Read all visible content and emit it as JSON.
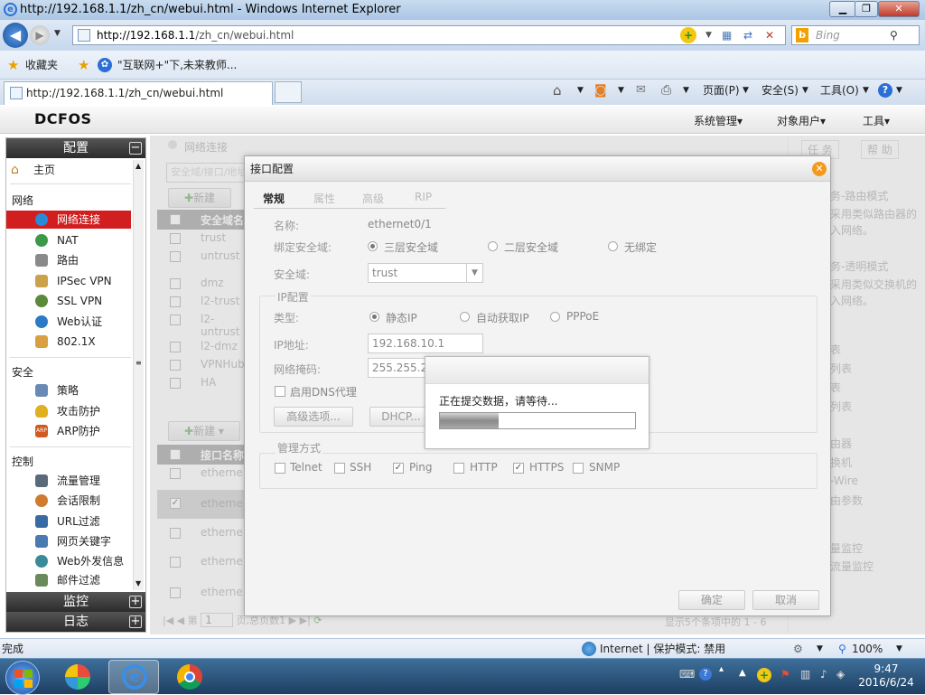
{
  "browser": {
    "title": "http://192.168.1.1/zh_cn/webui.html - Windows Internet Explorer",
    "address_host": "http://192.168.1.1",
    "address_path": "/zh_cn/webui.html",
    "search_placeholder": "Bing",
    "favorites_label": "收藏夹",
    "fav_link": "\"互联网+\"下,未来教师...",
    "tab_title": "http://192.168.1.1/zh_cn/webui.html",
    "cmd_page": "页面(P)",
    "cmd_safety": "安全(S)",
    "cmd_tools": "工具(O)"
  },
  "app": {
    "logo": "DCFOS",
    "menu_system": "系统管理",
    "menu_objects": "对象用户",
    "menu_tools": "工具"
  },
  "sidebar": {
    "config": "配置",
    "home": "主页",
    "group_network": "网络",
    "network_items": [
      "网络连接",
      "NAT",
      "路由",
      "IPSec VPN",
      "SSL VPN",
      "Web认证",
      "802.1X"
    ],
    "group_security": "安全",
    "security_items": [
      "策略",
      "攻击防护",
      "ARP防护"
    ],
    "group_control": "控制",
    "control_items": [
      "流量管理",
      "会话限制",
      "URL过滤",
      "网页关键字",
      "Web外发信息",
      "邮件过滤"
    ],
    "monitor": "监控",
    "log": "日志"
  },
  "main": {
    "breadcrumb": "网络连接",
    "search_hint": "安全域/接口/地址",
    "new_btn": "新建",
    "col_zone": "安全域名",
    "zones": [
      "trust",
      "untrust",
      "dmz",
      "l2-trust",
      "l2-untrust",
      "l2-dmz",
      "VPNHub",
      "HA"
    ],
    "col_iface": "接口名称",
    "ifaces": [
      "etherne",
      "etherne",
      "etherne",
      "etherne",
      "etherne"
    ],
    "pager_prefix": "第",
    "pager_suffix": "页,总页数1",
    "pager_page": "1",
    "pager_info": "显示5个条项中的 1 - 6",
    "right_tab_task": "任 务",
    "right_tab_help": "帮 助",
    "right_texts": [
      "务-路由模式",
      "采用类似路由器的",
      "入网络。",
      "务-透明模式",
      "采用类似交换机的",
      "入网络。",
      "表",
      "列表",
      "表",
      "列表",
      "由器",
      "换机",
      "-Wire",
      "由参数",
      "量监控",
      "流量监控"
    ]
  },
  "dialog": {
    "title": "接口配置",
    "tabs": [
      "常规",
      "属性",
      "高级",
      "RIP"
    ],
    "name_label": "名称:",
    "name_value": "ethernet0/1",
    "bind_label": "绑定安全域:",
    "bind_opts": [
      "三层安全域",
      "二层安全域",
      "无绑定"
    ],
    "zone_label": "安全域:",
    "zone_value": "trust",
    "ipconf_legend": "IP配置",
    "type_label": "类型:",
    "type_opts": [
      "静态IP",
      "自动获取IP",
      "PPPoE"
    ],
    "ip_label": "IP地址:",
    "ip_value": "192.168.10.1",
    "mask_label": "网络掩码:",
    "mask_value": "255.255.25",
    "dns_proxy": "启用DNS代理",
    "adv_btn": "高级选项...",
    "dhcp_btn": "DHCP...",
    "mgmt_legend": "管理方式",
    "mgmt": [
      {
        "label": "Telnet",
        "checked": false
      },
      {
        "label": "SSH",
        "checked": false
      },
      {
        "label": "Ping",
        "checked": true
      },
      {
        "label": "HTTP",
        "checked": false
      },
      {
        "label": "HTTPS",
        "checked": true
      },
      {
        "label": "SNMP",
        "checked": false
      }
    ],
    "ok_btn": "确定",
    "cancel_btn": "取消"
  },
  "progress": {
    "text": "正在提交数据，请等待...",
    "fraction": 0.3
  },
  "statusbar": {
    "done": "完成",
    "zone": "Internet | 保护模式: 禁用",
    "zoom": "100%"
  },
  "taskbar": {
    "time": "9:47",
    "date": "2016/6/24"
  },
  "colors": {
    "selected": "#d11e1e",
    "close_orange": "#f29a1e"
  }
}
